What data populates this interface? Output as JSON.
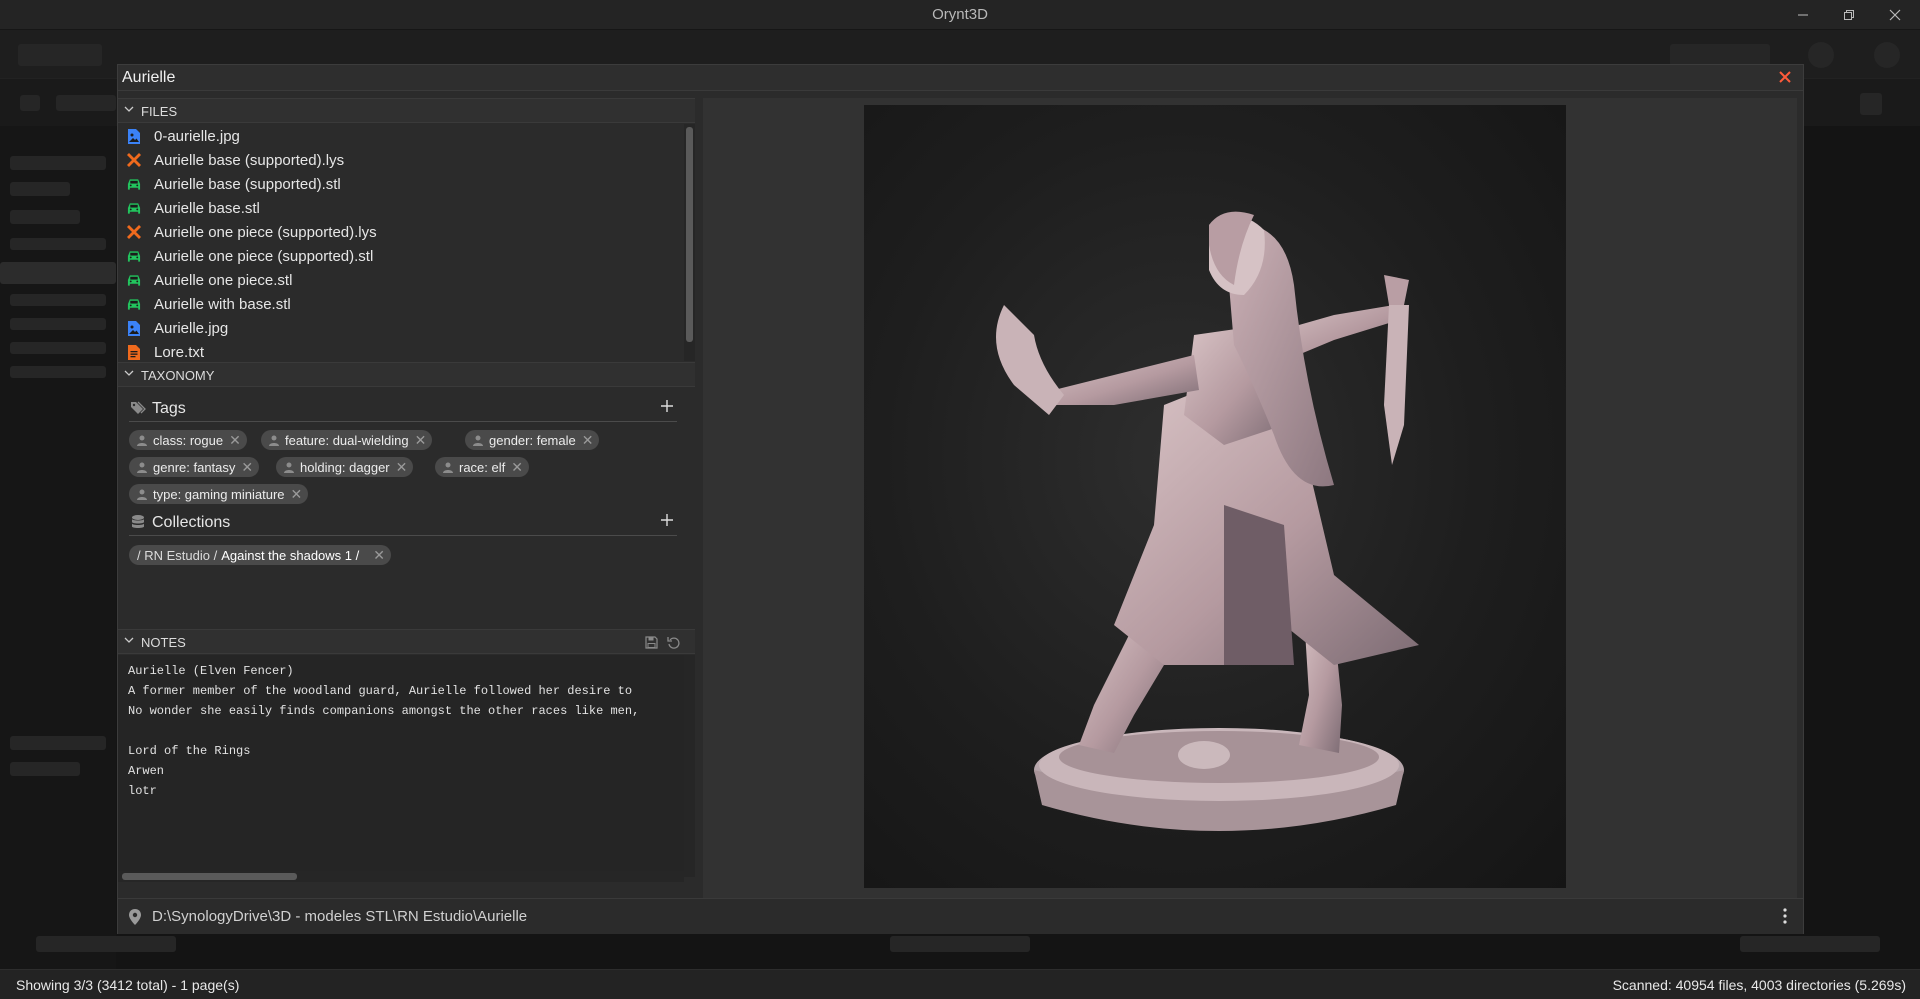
{
  "app": {
    "title": "Orynt3D"
  },
  "dialog": {
    "title": "Aurielle",
    "files_label": "FILES",
    "files": [
      {
        "name": "0-aurielle.jpg",
        "icon": "image-file-icon",
        "color": "#3b82f6"
      },
      {
        "name": "Aurielle base (supported).lys",
        "icon": "slicer-tools-icon",
        "color": "#f06a1d"
      },
      {
        "name": "Aurielle base (supported).stl",
        "icon": "model-car-icon",
        "color": "#22c55e"
      },
      {
        "name": "Aurielle base.stl",
        "icon": "model-car-icon",
        "color": "#22c55e"
      },
      {
        "name": "Aurielle one piece (supported).lys",
        "icon": "slicer-tools-icon",
        "color": "#f06a1d"
      },
      {
        "name": "Aurielle one piece (supported).stl",
        "icon": "model-car-icon",
        "color": "#22c55e"
      },
      {
        "name": "Aurielle one piece.stl",
        "icon": "model-car-icon",
        "color": "#22c55e"
      },
      {
        "name": "Aurielle with base.stl",
        "icon": "model-car-icon",
        "color": "#22c55e"
      },
      {
        "name": "Aurielle.jpg",
        "icon": "image-file-icon",
        "color": "#3b82f6"
      },
      {
        "name": "Lore.txt",
        "icon": "text-file-icon",
        "color": "#f06a1d"
      }
    ],
    "taxonomy_label": "TAXONOMY",
    "tags_label": "Tags",
    "tags": [
      "class: rogue",
      "feature: dual-wielding",
      "gender: female",
      "genre: fantasy",
      "holding: dagger",
      "race: elf",
      "type: gaming miniature"
    ],
    "collections_label": "Collections",
    "collection": {
      "prefix": "/ RN Estudio /",
      "name": "Against the shadows 1 /"
    },
    "notes_label": "NOTES",
    "notes_lines": [
      "Aurielle (Elven Fencer)",
      "A former member of the woodland guard, Aurielle followed her desire to",
      "No wonder she easily finds companions amongst the other races like men,",
      "",
      "Lord of the Rings",
      "Arwen",
      "lotr"
    ],
    "path": "D:\\SynologyDrive\\3D - modeles STL\\RN Estudio\\Aurielle"
  },
  "status": {
    "left": "Showing 3/3 (3412 total) - 1 page(s)",
    "right": "Scanned: 40954 files, 4003 directories (5.269s)"
  }
}
